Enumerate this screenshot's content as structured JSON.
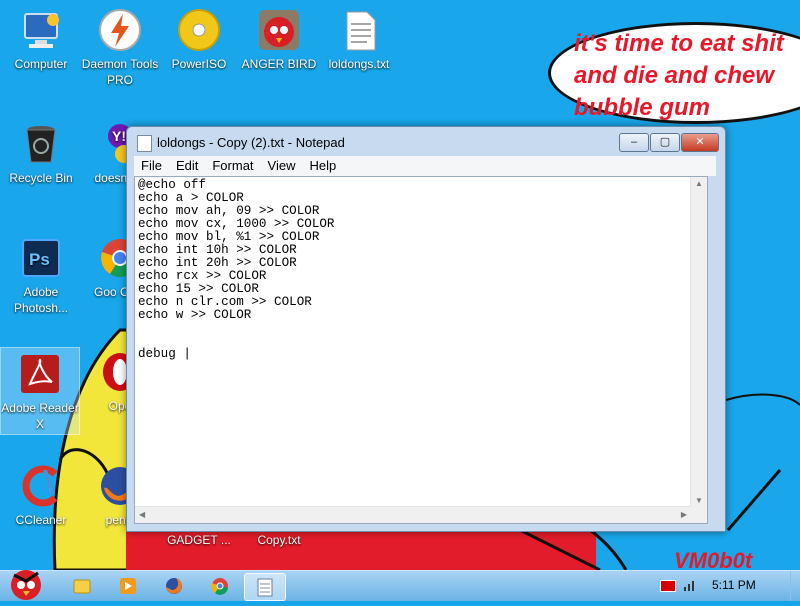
{
  "desktop": {
    "speech_bubble": "it's time to eat shit\nand die and chew\nbubble gum",
    "signature": "VM0b0t",
    "icons": [
      {
        "label": "Computer",
        "icon": "computer-icon"
      },
      {
        "label": "Daemon Tools PRO",
        "icon": "daemon-tools-icon"
      },
      {
        "label": "PowerISO",
        "icon": "poweriso-icon"
      },
      {
        "label": "ANGER BIRD",
        "icon": "angry-bird-icon"
      },
      {
        "label": "loldongs.txt",
        "icon": "text-file-icon"
      },
      {
        "label": "Recycle Bin",
        "icon": "recycle-bin-icon"
      },
      {
        "label": "doesn't lo",
        "icon": "yahoo-icon"
      },
      {
        "label": "Adobe Photosh...",
        "icon": "photoshop-icon"
      },
      {
        "label": "Goo Chro",
        "icon": "chrome-icon"
      },
      {
        "label": "Adobe Reader X",
        "icon": "adobe-reader-icon"
      },
      {
        "label": "Ope",
        "icon": "opera-icon"
      },
      {
        "label": "CCleaner",
        "icon": "ccleaner-icon"
      },
      {
        "label": "penis",
        "icon": "firefox-icon"
      },
      {
        "label": "GADGET ...",
        "icon": "gadget-icon"
      },
      {
        "label": "Copy.txt",
        "icon": "text-file-icon"
      }
    ]
  },
  "notepad": {
    "title": "loldongs - Copy (2).txt - Notepad",
    "menu": [
      "File",
      "Edit",
      "Format",
      "View",
      "Help"
    ],
    "content": "@echo off\necho a > COLOR\necho mov ah, 09 >> COLOR\necho mov cx, 1000 >> COLOR\necho mov bl, %1 >> COLOR\necho int 10h >> COLOR\necho int 20h >> COLOR\necho rcx >> COLOR\necho 15 >> COLOR\necho n clr.com >> COLOR\necho w >> COLOR\n\n\ndebug |",
    "buttons": {
      "minimize": "–",
      "maximize": "▢",
      "close": "✕"
    }
  },
  "taskbar": {
    "clock": "5:11 PM",
    "pinned": [
      "start-button",
      "explorer-icon",
      "media-player-icon",
      "firefox-icon",
      "chrome-icon",
      "notepad-icon"
    ]
  },
  "colors": {
    "desktop": "#19a6ea",
    "bubble_text": "#e8182a"
  }
}
